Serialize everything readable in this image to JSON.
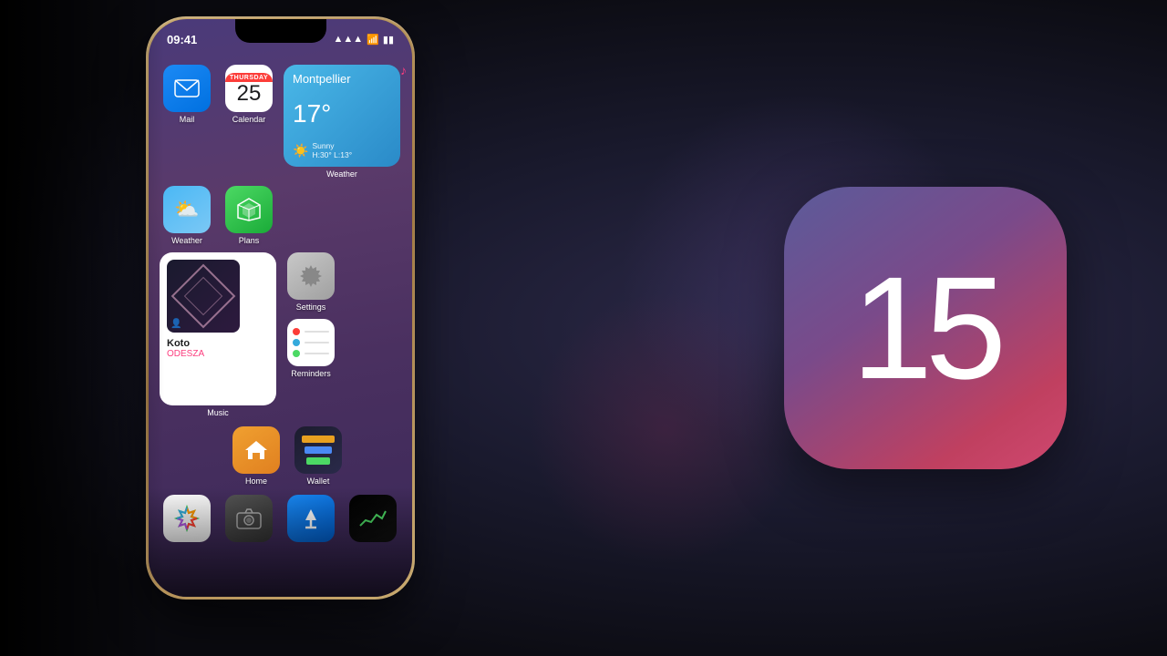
{
  "background": {
    "color": "#0a0a0f"
  },
  "ios15": {
    "number": "15"
  },
  "phone": {
    "status_bar": {
      "time": "09:41",
      "signal": "▲▲▲",
      "wifi": "wifi",
      "battery": "battery"
    },
    "apps": {
      "mail": {
        "label": "Mail"
      },
      "calendar": {
        "day": "THURSDAY",
        "date": "25",
        "label": "Calendar"
      },
      "weather_widget": {
        "city": "Montpellier",
        "temp": "17°",
        "condition": "Sunny",
        "high_low": "H:30° L:13°",
        "label": "Weather"
      },
      "weather_small": {
        "label": "Weather"
      },
      "plans": {
        "label": "Plans"
      },
      "music_widget": {
        "title": "Koto",
        "artist": "ODESZA",
        "label": "Music"
      },
      "settings": {
        "label": "Settings"
      },
      "reminders": {
        "label": "Reminders"
      },
      "home": {
        "label": "Home"
      },
      "wallet": {
        "label": "Wallet"
      },
      "photos": {
        "label": ""
      },
      "camera": {
        "label": ""
      },
      "appstore": {
        "label": ""
      },
      "stocks": {
        "label": ""
      }
    }
  }
}
